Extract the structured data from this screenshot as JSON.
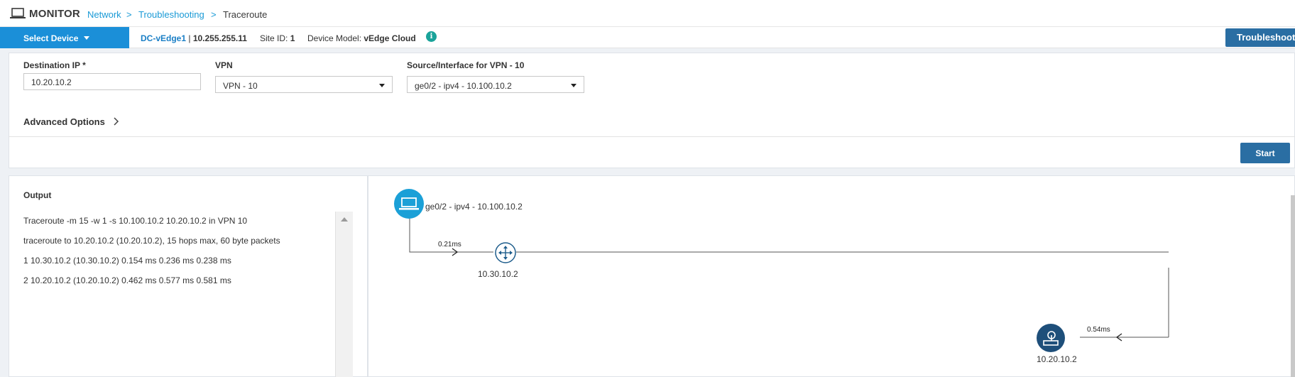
{
  "header": {
    "title": "MONITOR",
    "breadcrumb": [
      "Network",
      "Troubleshooting",
      "Traceroute"
    ],
    "sep": ">"
  },
  "device_bar": {
    "select_label": "Select Device",
    "device_name": "DC-vEdge1",
    "device_ip_sep": " | ",
    "device_ip": "10.255.255.11",
    "site_label": "Site ID: ",
    "site_id": "1",
    "model_label": "Device Model: ",
    "model": "vEdge Cloud",
    "info_icon": "i",
    "troubleshoot_label": "Troubleshooting"
  },
  "form": {
    "dest_label": "Destination IP *",
    "dest_value": "10.20.10.2",
    "vpn_label": "VPN",
    "vpn_value": "VPN - 10",
    "source_label": "Source/Interface for VPN - 10",
    "source_value": "ge0/2 - ipv4 - 10.100.10.2",
    "advanced_label": "Advanced Options",
    "start_label": "Start"
  },
  "output": {
    "title": "Output",
    "lines": [
      "Traceroute -m 15 -w 1 -s 10.100.10.2 10.20.10.2 in VPN 10",
      "traceroute to 10.20.10.2 (10.20.10.2), 15 hops max, 60 byte packets",
      "1 10.30.10.2 (10.30.10.2) 0.154 ms 0.236 ms 0.238 ms",
      "2 10.20.10.2 (10.20.10.2) 0.462 ms 0.577 ms 0.581 ms"
    ]
  },
  "diagram": {
    "source_label": "ge0/2 - ipv4 - 10.100.10.2",
    "hop1_label": "10.30.10.2",
    "hop1_latency": "0.21ms",
    "dest_label": "10.20.10.2",
    "dest_latency": "0.54ms",
    "colors": {
      "source_node": "#1ba0d7",
      "router_node": "#1e5d8c",
      "dest_node": "#1e4f7a",
      "link": "#555555"
    }
  },
  "icons": [
    "monitor-icon",
    "chevron-down-icon",
    "info-icon",
    "chevron-right-icon",
    "scroll-up-icon",
    "laptop-icon",
    "router-icon",
    "destination-icon",
    "arrow-icon"
  ]
}
